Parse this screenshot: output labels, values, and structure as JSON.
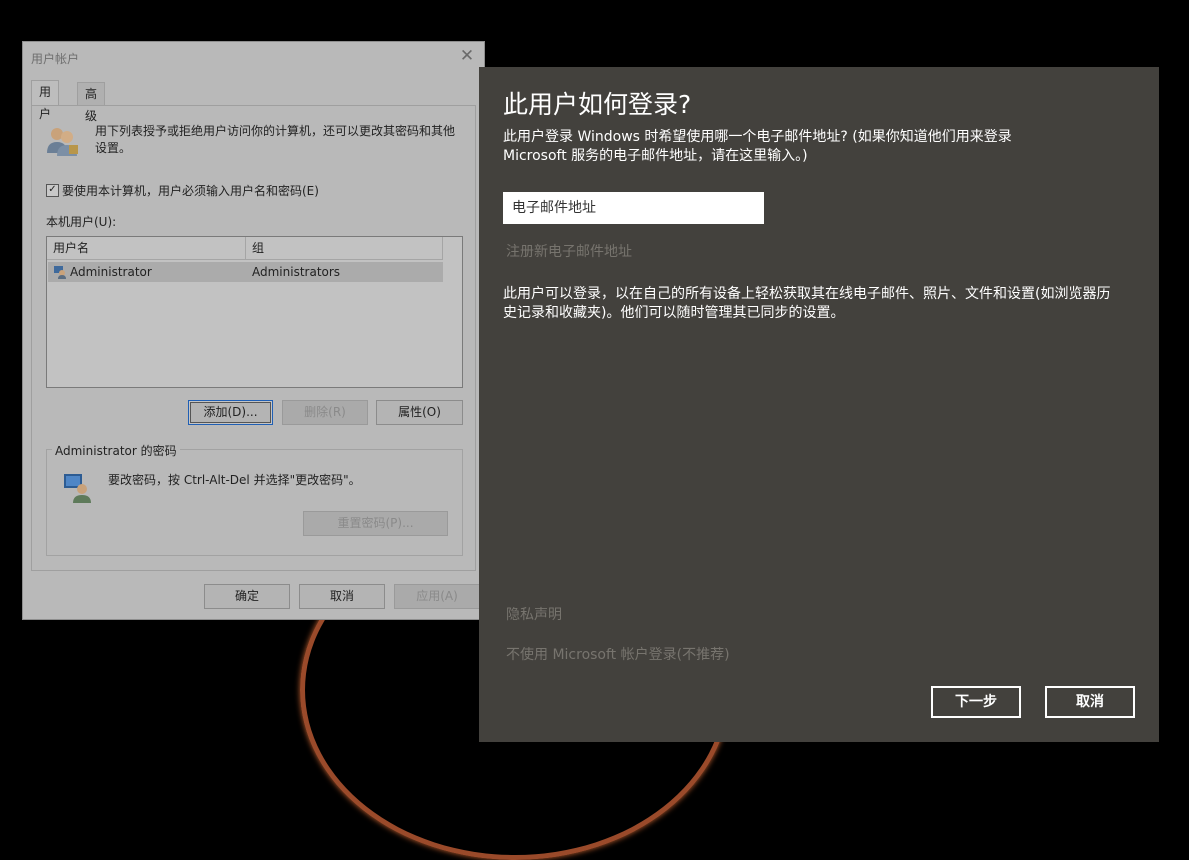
{
  "legacy_dialog": {
    "title": "用户帐户",
    "close_glyph": "✕",
    "tabs": [
      {
        "label": "用户"
      },
      {
        "label": "高级"
      }
    ],
    "intro_text": "用下列表授予或拒绝用户访问你的计算机，还可以更改其密码和其他设置。",
    "require_login_checkbox": {
      "label": "要使用本计算机，用户必须输入用户名和密码(E)",
      "checked": true,
      "glyph": "✓"
    },
    "local_users_label": "本机用户(U):",
    "columns": [
      "用户名",
      "组"
    ],
    "rows": [
      {
        "username": "Administrator",
        "group": "Administrators"
      }
    ],
    "buttons": {
      "add": "添加(D)...",
      "remove": "删除(R)",
      "properties": "属性(O)"
    },
    "password_group": {
      "title": "Administrator 的密码",
      "text": "要改密码，按 Ctrl-Alt-Del 并选择\"更改密码\"。",
      "reset_button": "重置密码(P)..."
    },
    "footer_buttons": {
      "ok": "确定",
      "cancel": "取消",
      "apply": "应用(A)"
    }
  },
  "modern_dialog": {
    "title": "此用户如何登录?",
    "description": "此用户登录 Windows 时希望使用哪一个电子邮件地址? (如果你知道他们用来登录 Microsoft 服务的电子邮件地址，请在这里输入。)",
    "email_placeholder": "电子邮件地址",
    "signup_link": "注册新电子邮件地址",
    "body_text": "此用户可以登录，以在自己的所有设备上轻松获取其在线电子邮件、照片、文件和设置(如浏览器历史记录和收藏夹)。他们可以随时管理其已同步的设置。",
    "privacy_link": "隐私声明",
    "no_ms_account_link": "不使用 Microsoft 帐户登录(不推荐)",
    "next_button": "下一步",
    "cancel_button": "取消"
  },
  "colors": {
    "modern_bg": "#43413d",
    "legacy_bg": "#b9b9b9",
    "desktop_bg": "#000000",
    "dim_link": "#77746e"
  }
}
